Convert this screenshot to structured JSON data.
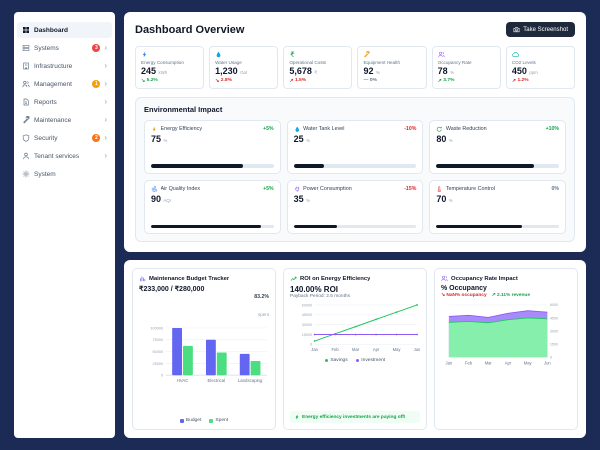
{
  "window": {
    "background": "#1c2b55"
  },
  "ui": {
    "chevron": "›"
  },
  "sidebar": {
    "items": [
      {
        "label": "Dashboard",
        "icon": "grid",
        "active": true
      },
      {
        "label": "Systems",
        "icon": "server",
        "badge": "3",
        "badge_color": "#ef4444"
      },
      {
        "label": "Infrastructure",
        "icon": "building"
      },
      {
        "label": "Management",
        "icon": "users",
        "badge": "1",
        "badge_color": "#f59e0b"
      },
      {
        "label": "Reports",
        "icon": "document"
      },
      {
        "label": "Maintenance",
        "icon": "wrench"
      },
      {
        "label": "Security",
        "icon": "shield",
        "badge": "2",
        "badge_color": "#f97316"
      },
      {
        "label": "Tenant services",
        "icon": "user"
      },
      {
        "label": "System",
        "icon": "gear"
      }
    ]
  },
  "header": {
    "title": "Dashboard Overview",
    "screenshot_button": {
      "label": "Take Screenshot",
      "icon": "camera"
    }
  },
  "kpis": [
    {
      "title": "Energy Consumption",
      "icon": "bolt",
      "icon_color": "#3b82f6",
      "value": "245",
      "unit": "kWh",
      "arrow": "↘",
      "change": "5.2%",
      "change_color": "#16a34a"
    },
    {
      "title": "Water Usage",
      "icon": "droplet",
      "icon_color": "#0ea5e9",
      "value": "1,230",
      "unit": "Gal",
      "arrow": "↘",
      "change": "2.8%",
      "change_color": "#dc2626"
    },
    {
      "title": "Operational Costs",
      "icon": "rupee",
      "icon_color": "#16a34a",
      "value": "5,678",
      "unit": "₹",
      "arrow": "↗",
      "change": "1.5%",
      "change_color": "#dc2626"
    },
    {
      "title": "Equipment Health",
      "icon": "wrench",
      "icon_color": "#f59e0b",
      "value": "92",
      "unit": "%",
      "arrow": "—",
      "change": "0%",
      "change_color": "#64748b"
    },
    {
      "title": "Occupancy Rate",
      "icon": "users",
      "icon_color": "#8b5cf6",
      "value": "78",
      "unit": "%",
      "arrow": "↗",
      "change": "3.7%",
      "change_color": "#16a34a"
    },
    {
      "title": "CO2 Levels",
      "icon": "cloud",
      "icon_color": "#14b8a6",
      "value": "450",
      "unit": "ppm",
      "arrow": "↗",
      "change": "1.2%",
      "change_color": "#dc2626"
    }
  ],
  "environmental": {
    "title": "Environmental Impact",
    "metrics": [
      {
        "name": "Energy Efficiency",
        "icon": "bolt",
        "icon_color": "#f59e0b",
        "value": "75",
        "unit": "%",
        "change": "+5%",
        "change_color": "#16a34a",
        "progress": 75
      },
      {
        "name": "Water Tank Level",
        "icon": "droplet",
        "icon_color": "#0ea5e9",
        "value": "25",
        "unit": "%",
        "change": "-10%",
        "change_color": "#dc2626",
        "progress": 25
      },
      {
        "name": "Waste Reduction",
        "icon": "recycle",
        "icon_color": "#16a34a",
        "value": "80",
        "unit": "%",
        "change": "+10%",
        "change_color": "#16a34a",
        "progress": 80
      },
      {
        "name": "Air Quality Index",
        "icon": "wind",
        "icon_color": "#3b82f6",
        "value": "90",
        "unit": "AQI",
        "change": "+5%",
        "change_color": "#16a34a",
        "progress": 90
      },
      {
        "name": "Power Consumption",
        "icon": "plug",
        "icon_color": "#8b5cf6",
        "value": "35",
        "unit": "%",
        "change": "-15%",
        "change_color": "#dc2626",
        "progress": 35
      },
      {
        "name": "Temperature Control",
        "icon": "thermometer",
        "icon_color": "#ef4444",
        "value": "70",
        "unit": "%",
        "change": "0%",
        "change_color": "#64748b",
        "progress": 70
      }
    ]
  },
  "analytics": {
    "budget": {
      "title": "Maintenance Budget Tracker",
      "icon": "chart",
      "icon_color": "#6366f1",
      "amount": "₹233,000 / ₹280,000",
      "spent_pct": "83.2%",
      "spent_label": "spent"
    },
    "roi": {
      "title": "ROI on Energy Efficiency",
      "icon": "trend",
      "icon_color": "#16a34a",
      "value": "140.00% ROI",
      "payback": "Payback Period: 2.5 months",
      "note": "Energy efficiency investments are paying off!",
      "note_icon": "bolt"
    },
    "occupancy": {
      "title": "Occupancy Rate Impact",
      "icon": "users",
      "icon_color": "#8b5cf6",
      "subtitle": "% Occupancy",
      "occupancy_change": "↘ NaN% occupancy",
      "occupancy_color": "#dc2626",
      "revenue_change": "↗ 2.11% revenue",
      "revenue_color": "#16a34a"
    }
  },
  "chart_data": [
    {
      "type": "bar",
      "title": "Maintenance Budget Tracker",
      "categories": [
        "HVAC",
        "Electrical",
        "Landscaping"
      ],
      "series": [
        {
          "name": "Budget",
          "color": "#6366f1",
          "values": [
            100000,
            75000,
            45000
          ]
        },
        {
          "name": "Spent",
          "color": "#4ade80",
          "values": [
            62000,
            48000,
            30000
          ]
        }
      ],
      "ylim": [
        0,
        100000
      ],
      "yticks": [
        0,
        25000,
        50000,
        75000,
        100000
      ],
      "legend_position": "bottom"
    },
    {
      "type": "line",
      "title": "ROI on Energy Efficiency",
      "x": [
        "Jan",
        "Feb",
        "Mar",
        "Apr",
        "May",
        "Jun"
      ],
      "series": [
        {
          "name": "Savings",
          "color": "#22c55e",
          "values": [
            5000,
            16000,
            27000,
            38000,
            49000,
            60000
          ]
        },
        {
          "name": "Investment",
          "color": "#8b5cf6",
          "values": [
            15000,
            15000,
            15000,
            15000,
            15000,
            15000
          ]
        }
      ],
      "ylim": [
        0,
        60000
      ],
      "yticks": [
        0,
        15000,
        30000,
        45000,
        60000
      ],
      "legend_position": "bottom"
    },
    {
      "type": "area",
      "title": "% Occupancy",
      "x": [
        "Jan",
        "Feb",
        "Mar",
        "Apr",
        "May",
        "Jun"
      ],
      "series": [
        {
          "name": "Occupancy %",
          "color": "#a78bfa",
          "axis": "left",
          "values": [
            78,
            80,
            76,
            84,
            89,
            86
          ]
        },
        {
          "name": "Revenue",
          "color": "#86efac",
          "axis": "right",
          "values": [
            4000,
            4100,
            3950,
            4300,
            4500,
            4400
          ]
        }
      ],
      "left_ylim": [
        0,
        100
      ],
      "right_ylim": [
        0,
        6000
      ],
      "right_yticks": [
        0,
        1500,
        3000,
        4500,
        6000
      ]
    }
  ]
}
